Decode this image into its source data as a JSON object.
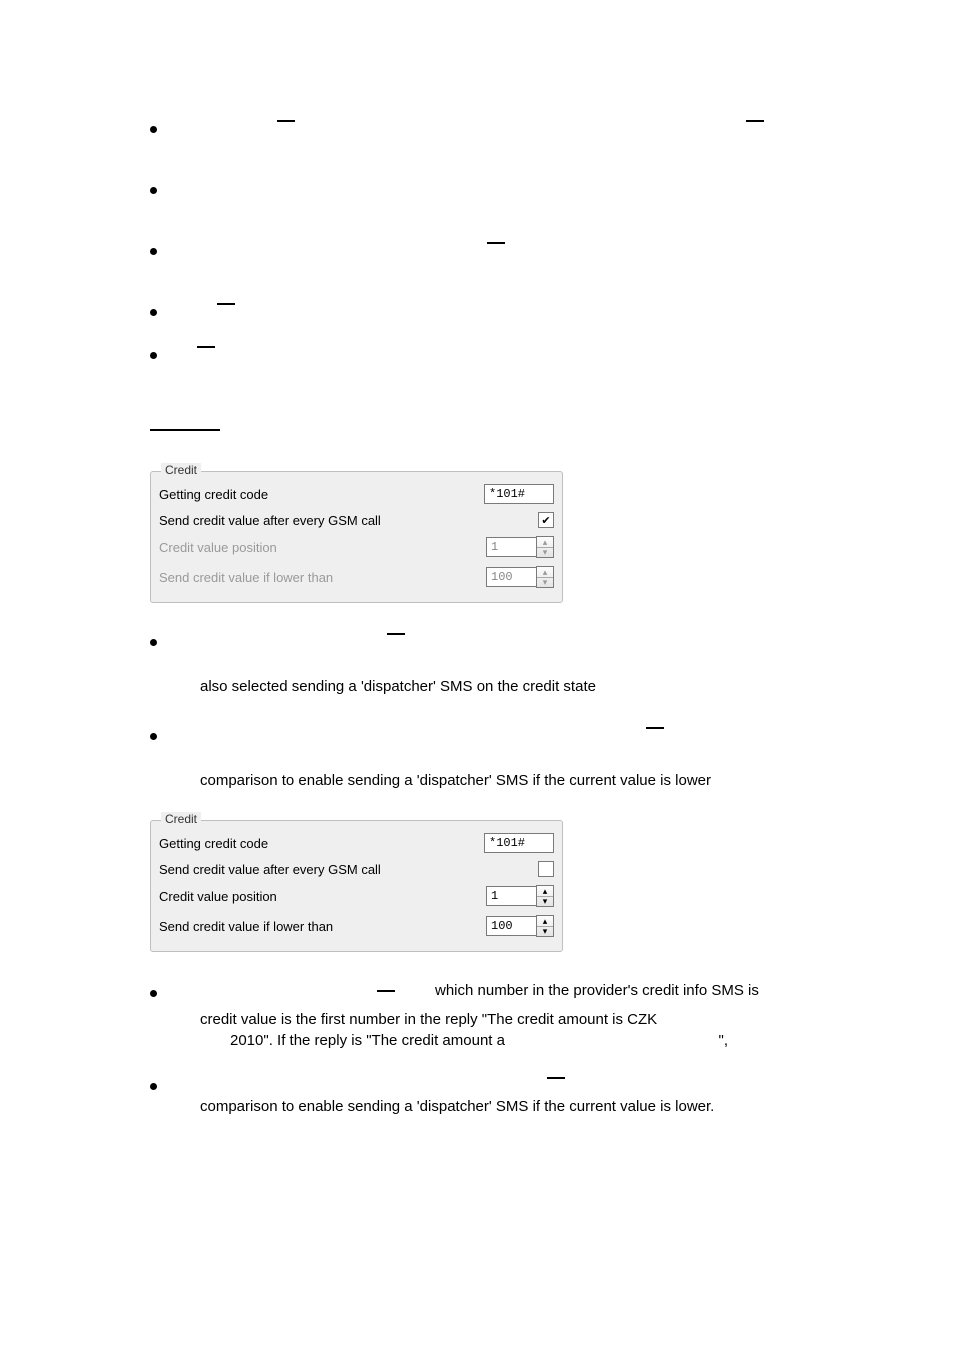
{
  "fieldset": {
    "legend": "Credit",
    "row1_label": "Getting credit code",
    "row1_value": "*101#",
    "row2_label": "Send credit value after every GSM call",
    "row3_label": "Credit value position",
    "row3_value": "1",
    "row4_label": "Send credit value if lower than",
    "row4_value": "100"
  },
  "text": {
    "p1": "also  selected  sending  a  'dispatcher'  SMS  on  the  credit  state",
    "p2": "comparison to enable sending a 'dispatcher' SMS if the current value is lower",
    "p3_a": "which number in the provider's credit info SMS is",
    "p3_b": "credit value is the first number in the reply \"The credit amount is CZK",
    "p3_c": "2010\". If the reply is \"The credit amount a",
    "p3_d": "\",",
    "p4": "comparison to enable sending a 'dispatcher' SMS if the current value is lower."
  }
}
